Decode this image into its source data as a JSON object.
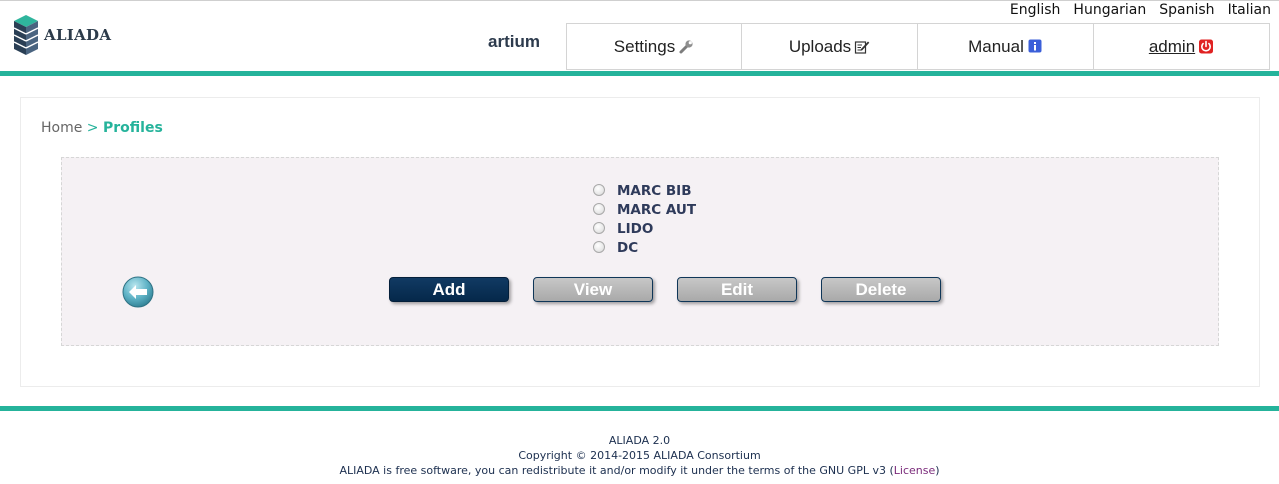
{
  "header": {
    "logo_text": "ALIADA",
    "languages": [
      "English",
      "Hungarian",
      "Spanish",
      "Italian"
    ],
    "username": "artium",
    "nav": [
      {
        "label": "Settings",
        "icon": "wrench-icon"
      },
      {
        "label": "Uploads",
        "icon": "edit-icon"
      },
      {
        "label": "Manual",
        "icon": "info-icon"
      },
      {
        "label": "admin",
        "icon": "power-icon"
      }
    ]
  },
  "breadcrumb": {
    "home": "Home",
    "separator": ">",
    "current": "Profiles"
  },
  "profiles": {
    "options": [
      "MARC BIB",
      "MARC AUT",
      "LIDO",
      "DC"
    ]
  },
  "buttons": {
    "add": "Add",
    "view": "View",
    "edit": "Edit",
    "delete": "Delete"
  },
  "footer": {
    "version": "ALIADA 2.0",
    "copyright": "Copyright © 2014-2015 ALIADA Consortium",
    "license_text": "ALIADA is free software, you can redistribute it and/or modify it under the terms of the GNU GPL v3 (",
    "license_link": "License",
    "license_close": ")"
  },
  "colors": {
    "accent": "#25b39b",
    "primary_button": "#0a3158",
    "disabled_button": "#b5b5b5",
    "panel_bg": "#f5f1f4"
  }
}
